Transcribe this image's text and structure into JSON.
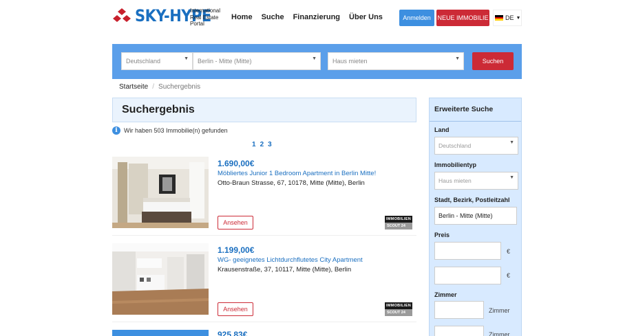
{
  "header": {
    "logo_text": "SKY-HYPE",
    "tagline": "International Real Estate Portal",
    "nav": [
      "Home",
      "Suche",
      "Finanzierung",
      "Über Uns"
    ],
    "login_label": "Anmelden",
    "new_property_label": "NEUE IMMOBILIE",
    "language": "DE"
  },
  "search": {
    "country": "Deutschland",
    "location": "Berlin - Mitte (Mitte)",
    "type": "Haus mieten",
    "button": "Suchen"
  },
  "breadcrumb": {
    "home": "Startseite",
    "current": "Suchergebnis"
  },
  "results": {
    "heading": "Suchergebnis",
    "info_text": "Wir haben 503 Immobilie(n) gefunden",
    "pages": [
      "1",
      "2",
      "3"
    ],
    "view_label": "Ansehen",
    "badge_top": "IMMOBILIEN",
    "badge_bottom": "SCOUT 24",
    "listings": [
      {
        "price": "1.690,00€",
        "title": "Möbliertes Junior 1 Bedroom Apartment in Berlin Mitte!",
        "address": "Otto-Braun Strasse, 67, 10178, Mitte (Mitte), Berlin"
      },
      {
        "price": "1.199,00€",
        "title": "WG- geeignetes Lichtdurchflutetes City Apartment",
        "address": "Krausenstraße, 37, 10117, Mitte (Mitte), Berlin"
      },
      {
        "price": "925,83€"
      }
    ]
  },
  "sidebar": {
    "title": "Erweiterte Suche",
    "land_label": "Land",
    "land_value": "Deutschland",
    "type_label": "Immobilientyp",
    "type_value": "Haus mieten",
    "location_label": "Stadt, Bezirk, Postleitzahl",
    "location_value": "Berlin - Mitte (Mitte)",
    "price_label": "Preis",
    "currency": "€",
    "rooms_label": "Zimmer",
    "rooms_unit": "Zimmer"
  },
  "colors": {
    "brand_blue": "#1a6fc0",
    "accent_red": "#cc2a36",
    "search_bar": "#5b9fea"
  }
}
